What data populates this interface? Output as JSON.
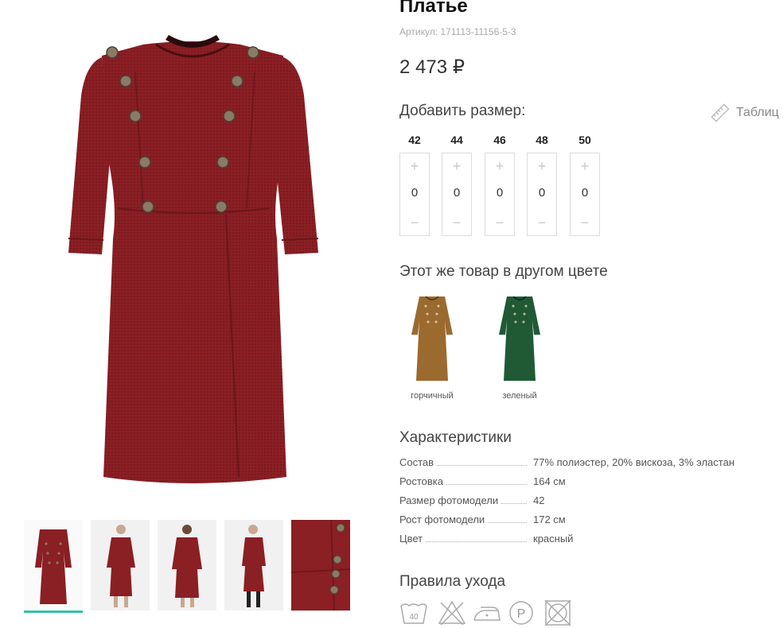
{
  "product": {
    "title": "Платье",
    "sku": "Артикул: 171113-11156-5-3",
    "price": "2 473 ₽"
  },
  "sizes": {
    "heading": "Добавить размер:",
    "table_link": "Таблиц",
    "items": [
      {
        "label": "42",
        "qty": "0"
      },
      {
        "label": "44",
        "qty": "0"
      },
      {
        "label": "46",
        "qty": "0"
      },
      {
        "label": "48",
        "qty": "0"
      },
      {
        "label": "50",
        "qty": "0"
      }
    ],
    "plus": "+",
    "minus": "−"
  },
  "colors": {
    "heading": "Этот же товар в другом цвете",
    "variants": [
      {
        "label": "горчичный",
        "color": "#9b6a2e"
      },
      {
        "label": "зеленый",
        "color": "#1f5a35"
      }
    ]
  },
  "specs": {
    "heading": "Характеристики",
    "rows": [
      {
        "key": "Состав",
        "value": "77% полиэстер, 20% вискоза, 3% эластан"
      },
      {
        "key": "Ростовка",
        "value": "164 см"
      },
      {
        "key": "Размер фотомодели",
        "value": "42"
      },
      {
        "key": "Рост фотомодели",
        "value": "172 см"
      },
      {
        "key": "Цвет",
        "value": "красный"
      }
    ]
  },
  "care": {
    "heading": "Правила ухода",
    "wash_temp": "40",
    "dryclean_letter": "P",
    "icons": [
      "wash-40-icon",
      "no-bleach-icon",
      "iron-low-icon",
      "dryclean-p-icon",
      "no-tumble-dry-icon"
    ]
  },
  "gallery": {
    "thumbnails": [
      "thumb-front-icon",
      "thumb-model-front-icon",
      "thumb-model-back-icon",
      "thumb-model-side-icon",
      "thumb-detail-icon"
    ],
    "active_index": 0
  },
  "theme": {
    "dress_color": "#8a1f24",
    "accent": "#33c3a6",
    "button_color": "#7a6b5a"
  }
}
